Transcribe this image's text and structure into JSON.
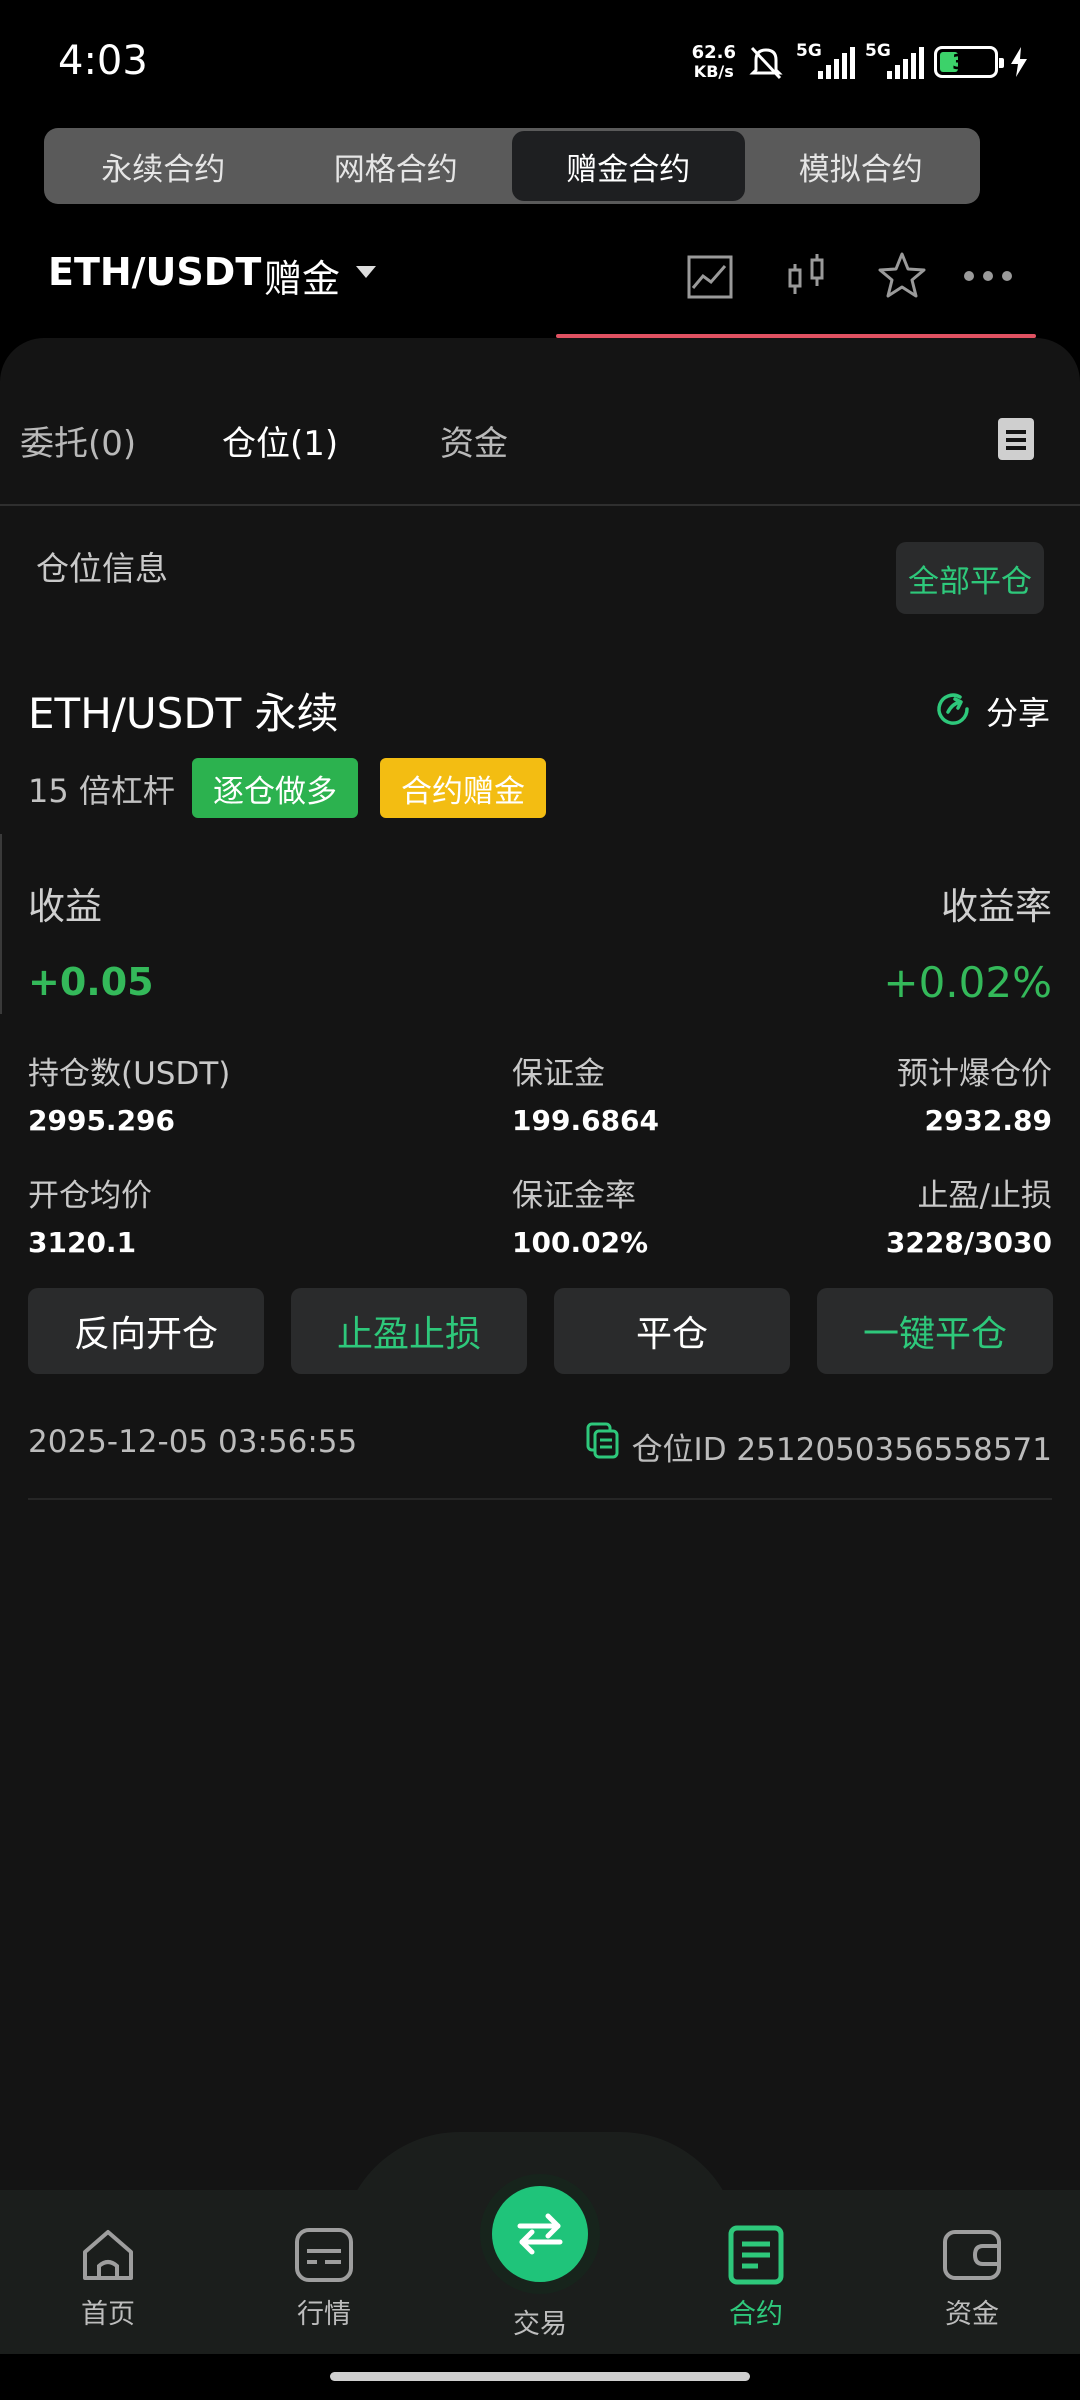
{
  "status_bar": {
    "time": "4:03",
    "net_speed_value": "62.6",
    "net_speed_unit": "KB/s",
    "sim1_label": "5G",
    "sim2_label": "5G",
    "battery": "34"
  },
  "contract_tabs": [
    {
      "label": "永续合约",
      "active": false
    },
    {
      "label": "网格合约",
      "active": false
    },
    {
      "label": "赠金合约",
      "active": true
    },
    {
      "label": "模拟合约",
      "active": false
    }
  ],
  "pair_header": {
    "pair": "ETH/USDT",
    "type": "赠金",
    "icons": [
      "chart-line-icon",
      "candlestick-icon",
      "star-icon",
      "more-icon"
    ]
  },
  "sub_tabs": {
    "orders": "委托(0)",
    "positions": "仓位(1)",
    "funds": "资金",
    "active": "positions"
  },
  "position_section": {
    "title": "仓位信息",
    "close_all": "全部平仓"
  },
  "position": {
    "symbol": "ETH/USDT 永续",
    "share": "分享",
    "leverage": "15 倍杠杆",
    "tag_side": "逐仓做多",
    "tag_bonus": "合约赠金",
    "pnl_label": "收益",
    "pnl_rate_label": "收益率",
    "pnl_value": "+0.05",
    "pnl_rate_value": "+0.02%",
    "size_label": "持仓数(USDT)",
    "size_value": "2995.296",
    "margin_label": "保证金",
    "margin_value": "199.6864",
    "liq_label": "预计爆仓价",
    "liq_value": "2932.89",
    "entry_label": "开仓均价",
    "entry_value": "3120.1",
    "margin_rate_label": "保证金率",
    "margin_rate_value": "100.02%",
    "tpsl_label": "止盈/止损",
    "tpsl_value": "3228/3030",
    "actions": {
      "reverse": "反向开仓",
      "tpsl": "止盈止损",
      "close": "平仓",
      "quick_close": "一键平仓"
    },
    "open_time": "2025-12-05 03:56:55",
    "position_id": "仓位ID 2512050356558571"
  },
  "bottom_nav": {
    "home": "首页",
    "market": "行情",
    "trade": "交易",
    "contract": "合约",
    "assets": "资金",
    "active": "contract"
  },
  "colors": {
    "green": "#2ec87b",
    "gain": "#34b95a",
    "bonus_tag": "#f3bd12",
    "tab_underline": "#e05262"
  }
}
